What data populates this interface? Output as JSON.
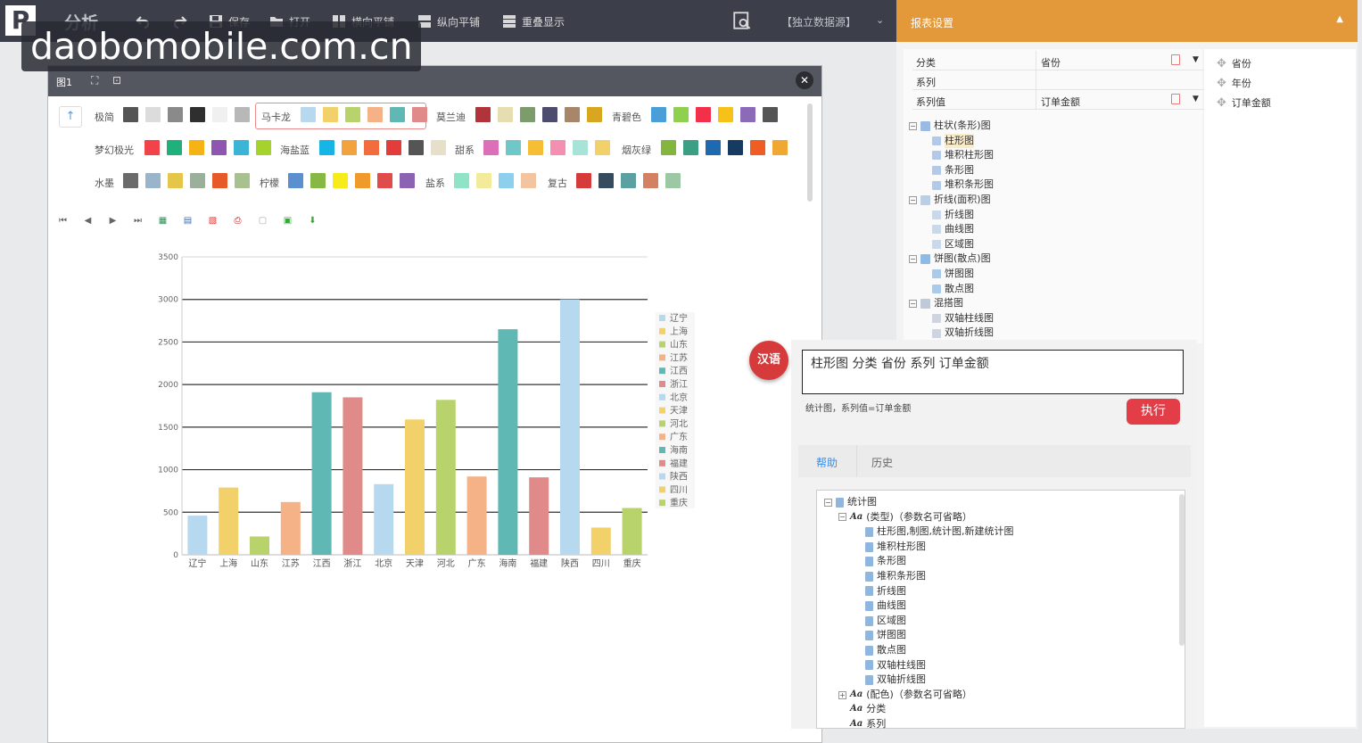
{
  "app": {
    "logo": "P",
    "title": "分析"
  },
  "toolbar": {
    "save": "保存",
    "open": "打开",
    "tile_h": "横向平铺",
    "tile_v": "纵向平铺",
    "overlay": "重叠显示",
    "datasource": "【独立数据源】"
  },
  "watermark": "daobomobile.com.cn",
  "report_settings": {
    "title": "报表设置",
    "rows": [
      {
        "key": "分类",
        "value": "省份"
      },
      {
        "key": "系列",
        "value": ""
      },
      {
        "key": "系列值",
        "value": "订单金额"
      }
    ],
    "fields": [
      "省份",
      "年份",
      "订单金额"
    ],
    "chart_tree": [
      {
        "label": "柱状(条形)图",
        "children": [
          "柱形图",
          "堆积柱形图",
          "条形图",
          "堆积条形图"
        ],
        "selected": "柱形图"
      },
      {
        "label": "折线(面积)图",
        "children": [
          "折线图",
          "曲线图",
          "区域图"
        ]
      },
      {
        "label": "饼图(散点)图",
        "children": [
          "饼图图",
          "散点图"
        ]
      },
      {
        "label": "混搭图",
        "children": [
          "双轴柱线图",
          "双轴折线图"
        ]
      }
    ]
  },
  "window": {
    "title": "图1"
  },
  "palette": {
    "groups": [
      {
        "name": "极简",
        "colors": [
          "#555555",
          "#dcdcdc",
          "#8a8a8a",
          "#2f2f2f",
          "#f0f0f0",
          "#b8b8b8"
        ]
      },
      {
        "name": "马卡龙",
        "colors": [
          "#b7d9f0",
          "#f2d16b",
          "#b8d36b",
          "#f5b287",
          "#5fb8b3",
          "#e08a8a"
        ]
      },
      {
        "name": "莫兰迪",
        "colors": [
          "#b2343b",
          "#e6ddb0",
          "#7c9c6b",
          "#4d4b6e",
          "#a7866a",
          "#d9a71f"
        ]
      },
      {
        "name": "青碧色",
        "colors": [
          "#4a9fd8",
          "#8fd14f",
          "#f2304a",
          "#f6c21a",
          "#8b6bb8",
          "#555555"
        ]
      },
      {
        "name": "梦幻极光",
        "colors": [
          "#f2424a",
          "#20b07c",
          "#f5b315",
          "#8e56b0",
          "#3cb4d6",
          "#a5d22c"
        ]
      },
      {
        "name": "海盐蓝",
        "colors": [
          "#17b5e6",
          "#f3a33e",
          "#f36c3e",
          "#e23c3c",
          "#555555",
          "#e8dfc8"
        ]
      },
      {
        "name": "甜系",
        "colors": [
          "#dd6fb9",
          "#6fc8c7",
          "#f6bf33",
          "#f58fb2",
          "#a8e3d8",
          "#f2d16b"
        ]
      },
      {
        "name": "烟灰绿",
        "colors": [
          "#84b53f",
          "#3b9f83",
          "#1f69b1",
          "#173a61",
          "#ef5d24",
          "#f1a833"
        ]
      },
      {
        "name": "水墨",
        "colors": [
          "#6b6b6b",
          "#9ab5c9",
          "#e6c54b",
          "#9ab09a",
          "#e8592a",
          "#a9c08f"
        ]
      },
      {
        "name": "柠檬",
        "colors": [
          "#5b8fcf",
          "#86b844",
          "#f7ec1a",
          "#f09a2b",
          "#e04b4b",
          "#8c62b3"
        ]
      },
      {
        "name": "盐系",
        "colors": [
          "#8fe3c7",
          "#f3eb9b",
          "#8cd0ee",
          "#f2c4a0"
        ]
      },
      {
        "name": "复古",
        "colors": [
          "#d63b3b",
          "#354b5e",
          "#5ba1a1",
          "#d48163",
          "#9cc8a5"
        ]
      }
    ]
  },
  "chart_data": {
    "type": "bar",
    "categories": [
      "辽宁",
      "上海",
      "山东",
      "江苏",
      "江西",
      "浙江",
      "北京",
      "天津",
      "河北",
      "广东",
      "海南",
      "福建",
      "陕西",
      "四川",
      "重庆"
    ],
    "values": [
      460,
      790,
      215,
      620,
      1910,
      1850,
      830,
      1590,
      1820,
      920,
      2650,
      910,
      3000,
      320,
      550
    ],
    "colors": [
      "#b7d9f0",
      "#f2d16b",
      "#b8d36b",
      "#f5b287",
      "#5fb8b3",
      "#e08a8a",
      "#b7d9f0",
      "#f2d16b",
      "#b8d36b",
      "#f5b287",
      "#5fb8b3",
      "#e08a8a",
      "#b7d9f0",
      "#f2d16b",
      "#b8d36b"
    ],
    "ylim": [
      0,
      3500
    ],
    "yticks": [
      0,
      500,
      1000,
      1500,
      2000,
      2500,
      3000,
      3500
    ],
    "grid": true,
    "legend_position": "right"
  },
  "command": {
    "badge": "汉语",
    "input": "柱形图 分类 省份 系列 订单金额",
    "hint": "统计图，系列值=订单金额",
    "run": "执行",
    "tabs": [
      "帮助",
      "历史"
    ],
    "help_tree": {
      "root": "统计图",
      "type_node": "(类型)（参数名可省略）",
      "types": [
        "柱形图,制图,统计图,新建统计图",
        "堆积柱形图",
        "条形图",
        "堆积条形图",
        "折线图",
        "曲线图",
        "区域图",
        "饼图图",
        "散点图",
        "双轴柱线图",
        "双轴折线图"
      ],
      "color_node": "(配色)（参数名可省略）",
      "category_node": "分类",
      "series_node": "系列"
    }
  }
}
